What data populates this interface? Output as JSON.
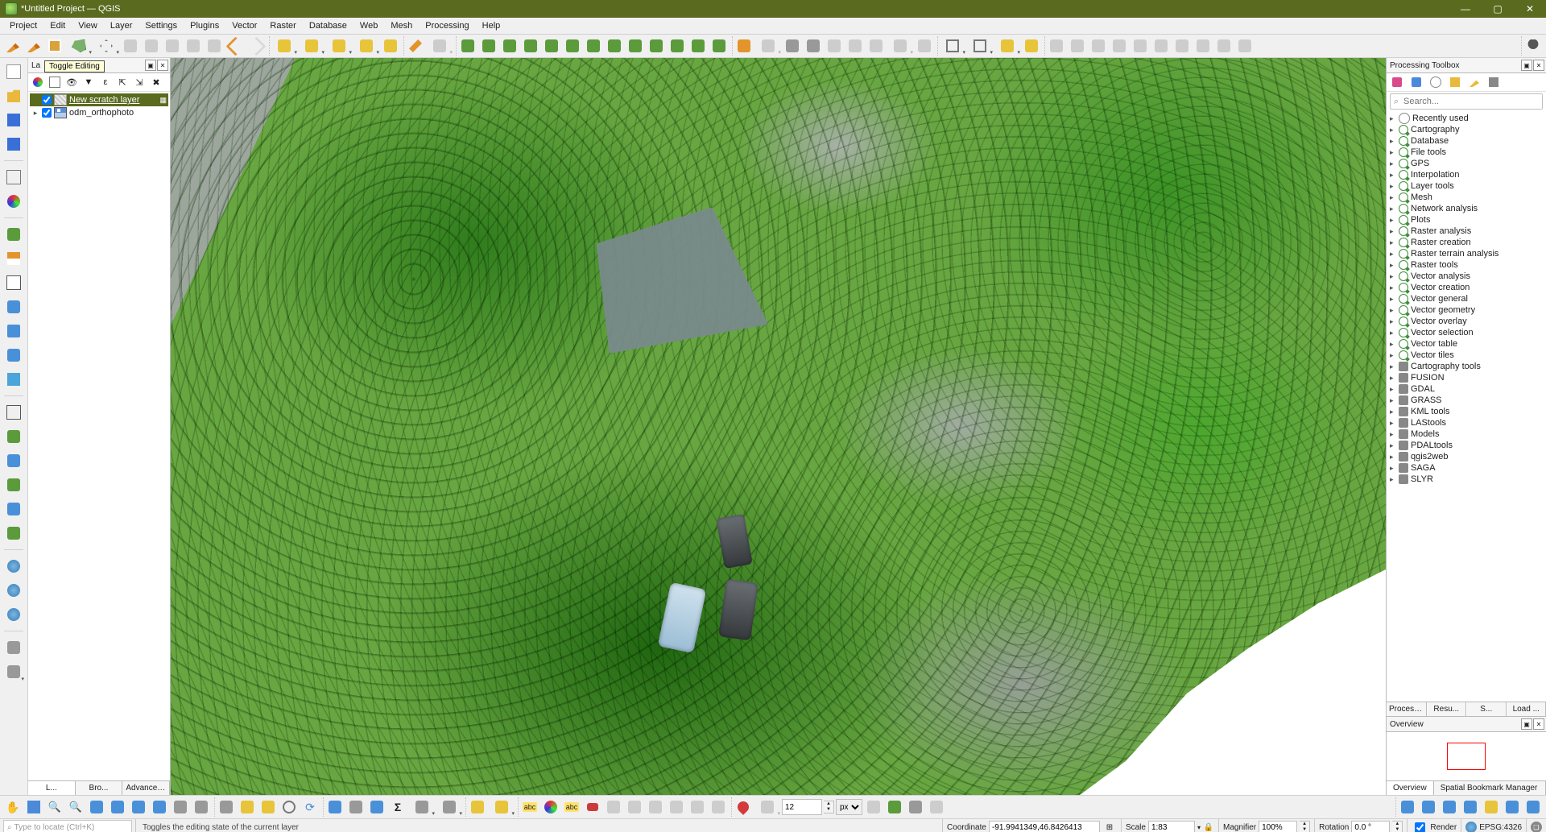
{
  "title": "*Untitled Project — QGIS",
  "tooltip": "Toggle Editing",
  "menu": [
    "Project",
    "Edit",
    "View",
    "Layer",
    "Settings",
    "Plugins",
    "Vector",
    "Raster",
    "Database",
    "Web",
    "Mesh",
    "Processing",
    "Help"
  ],
  "layers_panel": {
    "title_abbrev": "La",
    "tabs": [
      "L...",
      "Bro...",
      "Advanced Digiti..."
    ],
    "items": [
      {
        "name": "New scratch layer",
        "selected": true,
        "checked": true,
        "icon": "scratch",
        "expandable": false,
        "extra": true
      },
      {
        "name": "odm_orthophoto",
        "selected": false,
        "checked": true,
        "icon": "raster",
        "expandable": true
      }
    ]
  },
  "processing": {
    "title": "Processing Toolbox",
    "search_placeholder": "Search...",
    "groups": [
      {
        "label": "Recently used",
        "icon": "clock"
      },
      {
        "label": "Cartography",
        "icon": "q"
      },
      {
        "label": "Database",
        "icon": "q"
      },
      {
        "label": "File tools",
        "icon": "q"
      },
      {
        "label": "GPS",
        "icon": "q"
      },
      {
        "label": "Interpolation",
        "icon": "q"
      },
      {
        "label": "Layer tools",
        "icon": "q"
      },
      {
        "label": "Mesh",
        "icon": "q"
      },
      {
        "label": "Network analysis",
        "icon": "q"
      },
      {
        "label": "Plots",
        "icon": "q"
      },
      {
        "label": "Raster analysis",
        "icon": "q"
      },
      {
        "label": "Raster creation",
        "icon": "q"
      },
      {
        "label": "Raster terrain analysis",
        "icon": "q"
      },
      {
        "label": "Raster tools",
        "icon": "q"
      },
      {
        "label": "Vector analysis",
        "icon": "q"
      },
      {
        "label": "Vector creation",
        "icon": "q"
      },
      {
        "label": "Vector general",
        "icon": "q"
      },
      {
        "label": "Vector geometry",
        "icon": "q"
      },
      {
        "label": "Vector overlay",
        "icon": "q"
      },
      {
        "label": "Vector selection",
        "icon": "q"
      },
      {
        "label": "Vector table",
        "icon": "q"
      },
      {
        "label": "Vector tiles",
        "icon": "q"
      },
      {
        "label": "Cartography tools",
        "icon": "p"
      },
      {
        "label": "FUSION",
        "icon": "p"
      },
      {
        "label": "GDAL",
        "icon": "p"
      },
      {
        "label": "GRASS",
        "icon": "p"
      },
      {
        "label": "KML tools",
        "icon": "p"
      },
      {
        "label": "LAStools",
        "icon": "p"
      },
      {
        "label": "Models",
        "icon": "p"
      },
      {
        "label": "PDALtools",
        "icon": "p"
      },
      {
        "label": "qgis2web",
        "icon": "p"
      },
      {
        "label": "SAGA",
        "icon": "p"
      },
      {
        "label": "SLYR",
        "icon": "p"
      }
    ],
    "buttons": [
      "Processin...",
      "Resu...",
      "S...",
      "Load ..."
    ],
    "overview_title": "Overview",
    "lower_tabs": [
      "Overview",
      "Spatial Bookmark Manager"
    ]
  },
  "statusbar": {
    "locator_placeholder": "Type to locate (Ctrl+K)",
    "message": "Toggles the editing state of the current layer",
    "coordinate_label": "Coordinate",
    "coordinate_value": "-91.9941349,46.8426413",
    "scale_label": "Scale",
    "scale_value": "1:83",
    "magnifier_label": "Magnifier",
    "magnifier_value": "100%",
    "rotation_label": "Rotation",
    "rotation_value": "0.0 °",
    "render_label": "Render",
    "crs_label": "EPSG:4326"
  },
  "snap": {
    "value": "12",
    "unit": "px"
  }
}
